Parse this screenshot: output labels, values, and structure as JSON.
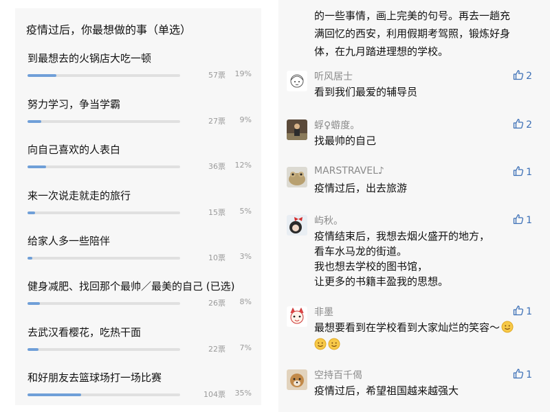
{
  "poll": {
    "title": "疫情过后，你最想做的事（单选）",
    "options": [
      {
        "label": "到最想去的火锅店大吃一顿",
        "votes": "57票",
        "percent": "19%",
        "fill": 0.19
      },
      {
        "label": "努力学习，争当学霸",
        "votes": "27票",
        "percent": "9%",
        "fill": 0.09
      },
      {
        "label": "向自己喜欢的人表白",
        "votes": "36票",
        "percent": "12%",
        "fill": 0.12
      },
      {
        "label": "来一次说走就走的旅行",
        "votes": "15票",
        "percent": "5%",
        "fill": 0.05
      },
      {
        "label": "给家人多一些陪伴",
        "votes": "10票",
        "percent": "3%",
        "fill": 0.03
      },
      {
        "label": "健身减肥、找回那个最帅／最美的自己 (已选)",
        "votes": "26票",
        "percent": "8%",
        "fill": 0.08
      },
      {
        "label": "去武汉看樱花，吃热干面",
        "votes": "22票",
        "percent": "7%",
        "fill": 0.07
      },
      {
        "label": "和好朋友去篮球场打一场比赛",
        "votes": "104票",
        "percent": "35%",
        "fill": 0.35
      }
    ],
    "bar_color": "#6f9fd8"
  },
  "comments": {
    "top_text_lines": [
      "的一些事情，画上完美的句号。再去一趟充",
      "满回忆的西安，利用假期考驾照，锻炼好身",
      "体，在九月踏进理想的学校。"
    ],
    "items": [
      {
        "name": "听风居士",
        "lines": [
          "看到我们最爱的辅导员"
        ],
        "likes": "2",
        "avatar_icon": "sketch-girl-avatar"
      },
      {
        "name": "蜉♀蝣度。",
        "lines": [
          "找最帅的自己"
        ],
        "likes": "2",
        "avatar_icon": "person-photo-avatar"
      },
      {
        "name": "MARSTRAVEL♪",
        "lines": [
          "疫情过后，出去旅游"
        ],
        "likes": "1",
        "avatar_icon": "frog-avatar"
      },
      {
        "name": "屿秋。",
        "lines": [
          "疫情结束后，我想去烟火盛开的地方，",
          "看车水马龙的街道。",
          "我也想去学校的图书馆，",
          "让更多的书籍丰盈我的思想。"
        ],
        "likes": "1",
        "avatar_icon": "girl-red-bow-avatar"
      },
      {
        "name": "非墨",
        "lines": [
          "最想要看到在学校看到大家灿烂的笑容～",
          ""
        ],
        "likes": "1",
        "avatar_icon": "cartoon-cat-avatar",
        "emoji": "smile-emoji"
      },
      {
        "name": "空持百千偈",
        "lines": [
          "疫情过后，希望祖国越来越强大"
        ],
        "likes": "1",
        "avatar_icon": "dog-photo-avatar"
      }
    ],
    "like_color": "#3b6fb6"
  }
}
